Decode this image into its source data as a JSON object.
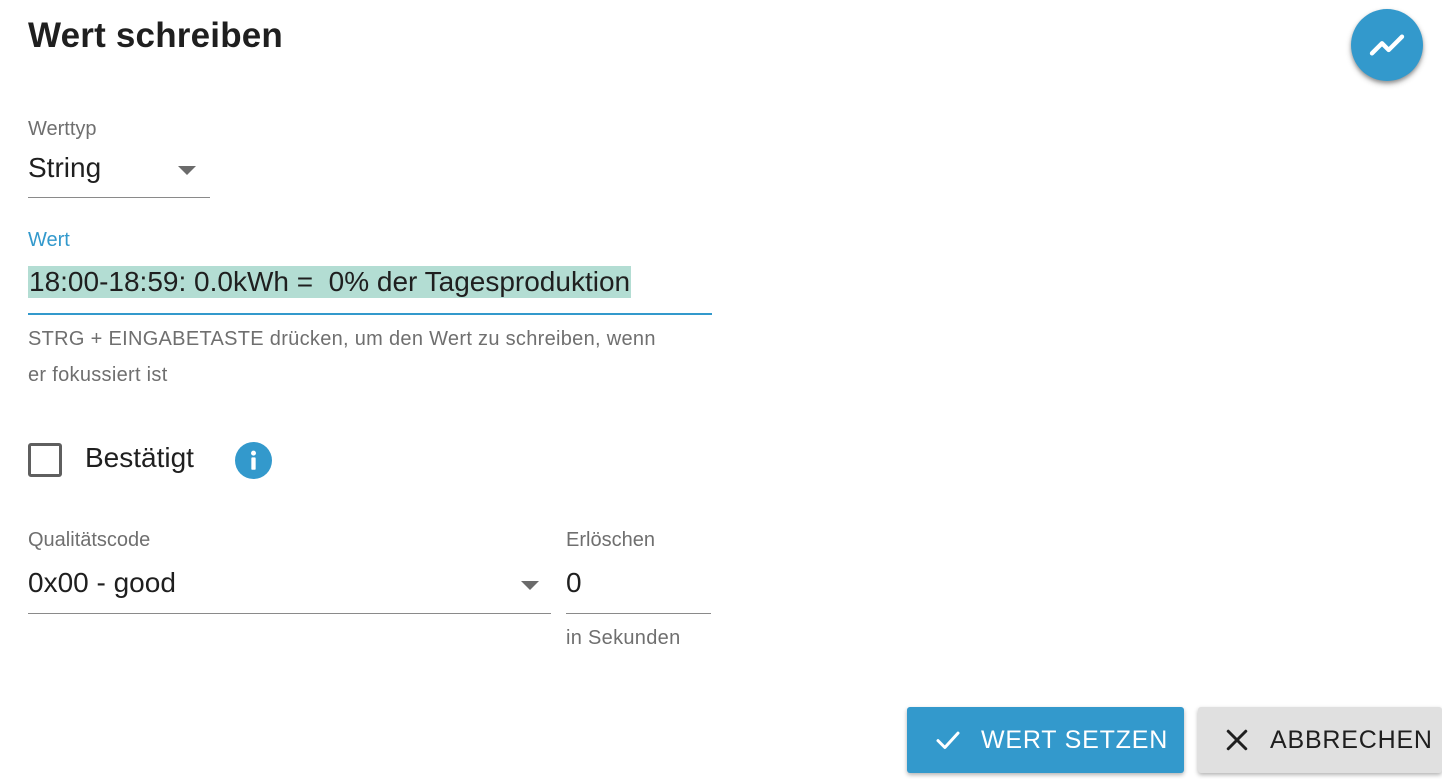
{
  "dialog": {
    "title": "Wert schreiben"
  },
  "fab": {
    "icon": "trending-up-icon"
  },
  "value_type": {
    "label": "Werttyp",
    "selected": "String"
  },
  "value_field": {
    "label": "Wert",
    "value": "18:00-18:59: 0.0kWh =  0% der Tagesproduktion",
    "helper_line1": "STRG + EINGABETASTE drücken, um den Wert zu schreiben, wenn",
    "helper_line2": "er fokussiert ist"
  },
  "ack": {
    "label": "Bestätigt",
    "checked": false,
    "info_icon": "info-icon"
  },
  "quality": {
    "label": "Qualitätscode",
    "selected": "0x00 - good"
  },
  "expire": {
    "label": "Erlöschen",
    "value": "0",
    "helper": "in Sekunden"
  },
  "buttons": {
    "set_label": "WERT SETZEN",
    "cancel_label": "ABBRECHEN"
  },
  "colors": {
    "primary": "#3399cc",
    "selection": "#b3ddd3",
    "secondary_button": "#e0e0e0"
  }
}
